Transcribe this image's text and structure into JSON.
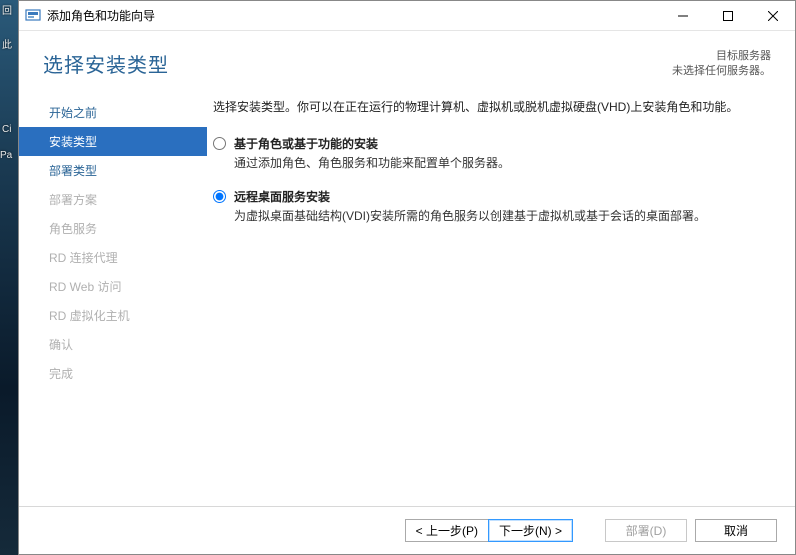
{
  "edge": {
    "t1": "回",
    "t2": "此",
    "t3": "Ci",
    "t4": "Pa"
  },
  "titlebar": {
    "title": "添加角色和功能向导"
  },
  "header": {
    "heading": "选择安装类型",
    "dest_label": "目标服务器",
    "dest_status": "未选择任何服务器。"
  },
  "nav": {
    "items": [
      {
        "label": "开始之前",
        "state": "normal"
      },
      {
        "label": "安装类型",
        "state": "active"
      },
      {
        "label": "部署类型",
        "state": "normal"
      },
      {
        "label": "部署方案",
        "state": "disabled"
      },
      {
        "label": "角色服务",
        "state": "disabled"
      },
      {
        "label": "RD 连接代理",
        "state": "disabled"
      },
      {
        "label": "RD Web 访问",
        "state": "disabled"
      },
      {
        "label": "RD 虚拟化主机",
        "state": "disabled"
      },
      {
        "label": "确认",
        "state": "disabled"
      },
      {
        "label": "完成",
        "state": "disabled"
      }
    ]
  },
  "content": {
    "intro": "选择安装类型。你可以在正在运行的物理计算机、虚拟机或脱机虚拟硬盘(VHD)上安装角色和功能。",
    "options": [
      {
        "title": "基于角色或基于功能的安装",
        "desc": "通过添加角色、角色服务和功能来配置单个服务器。",
        "selected": false
      },
      {
        "title": "远程桌面服务安装",
        "desc": "为虚拟桌面基础结构(VDI)安装所需的角色服务以创建基于虚拟机或基于会话的桌面部署。",
        "selected": true
      }
    ]
  },
  "footer": {
    "prev": "< 上一步(P)",
    "next": "下一步(N) >",
    "deploy": "部署(D)",
    "cancel": "取消"
  }
}
